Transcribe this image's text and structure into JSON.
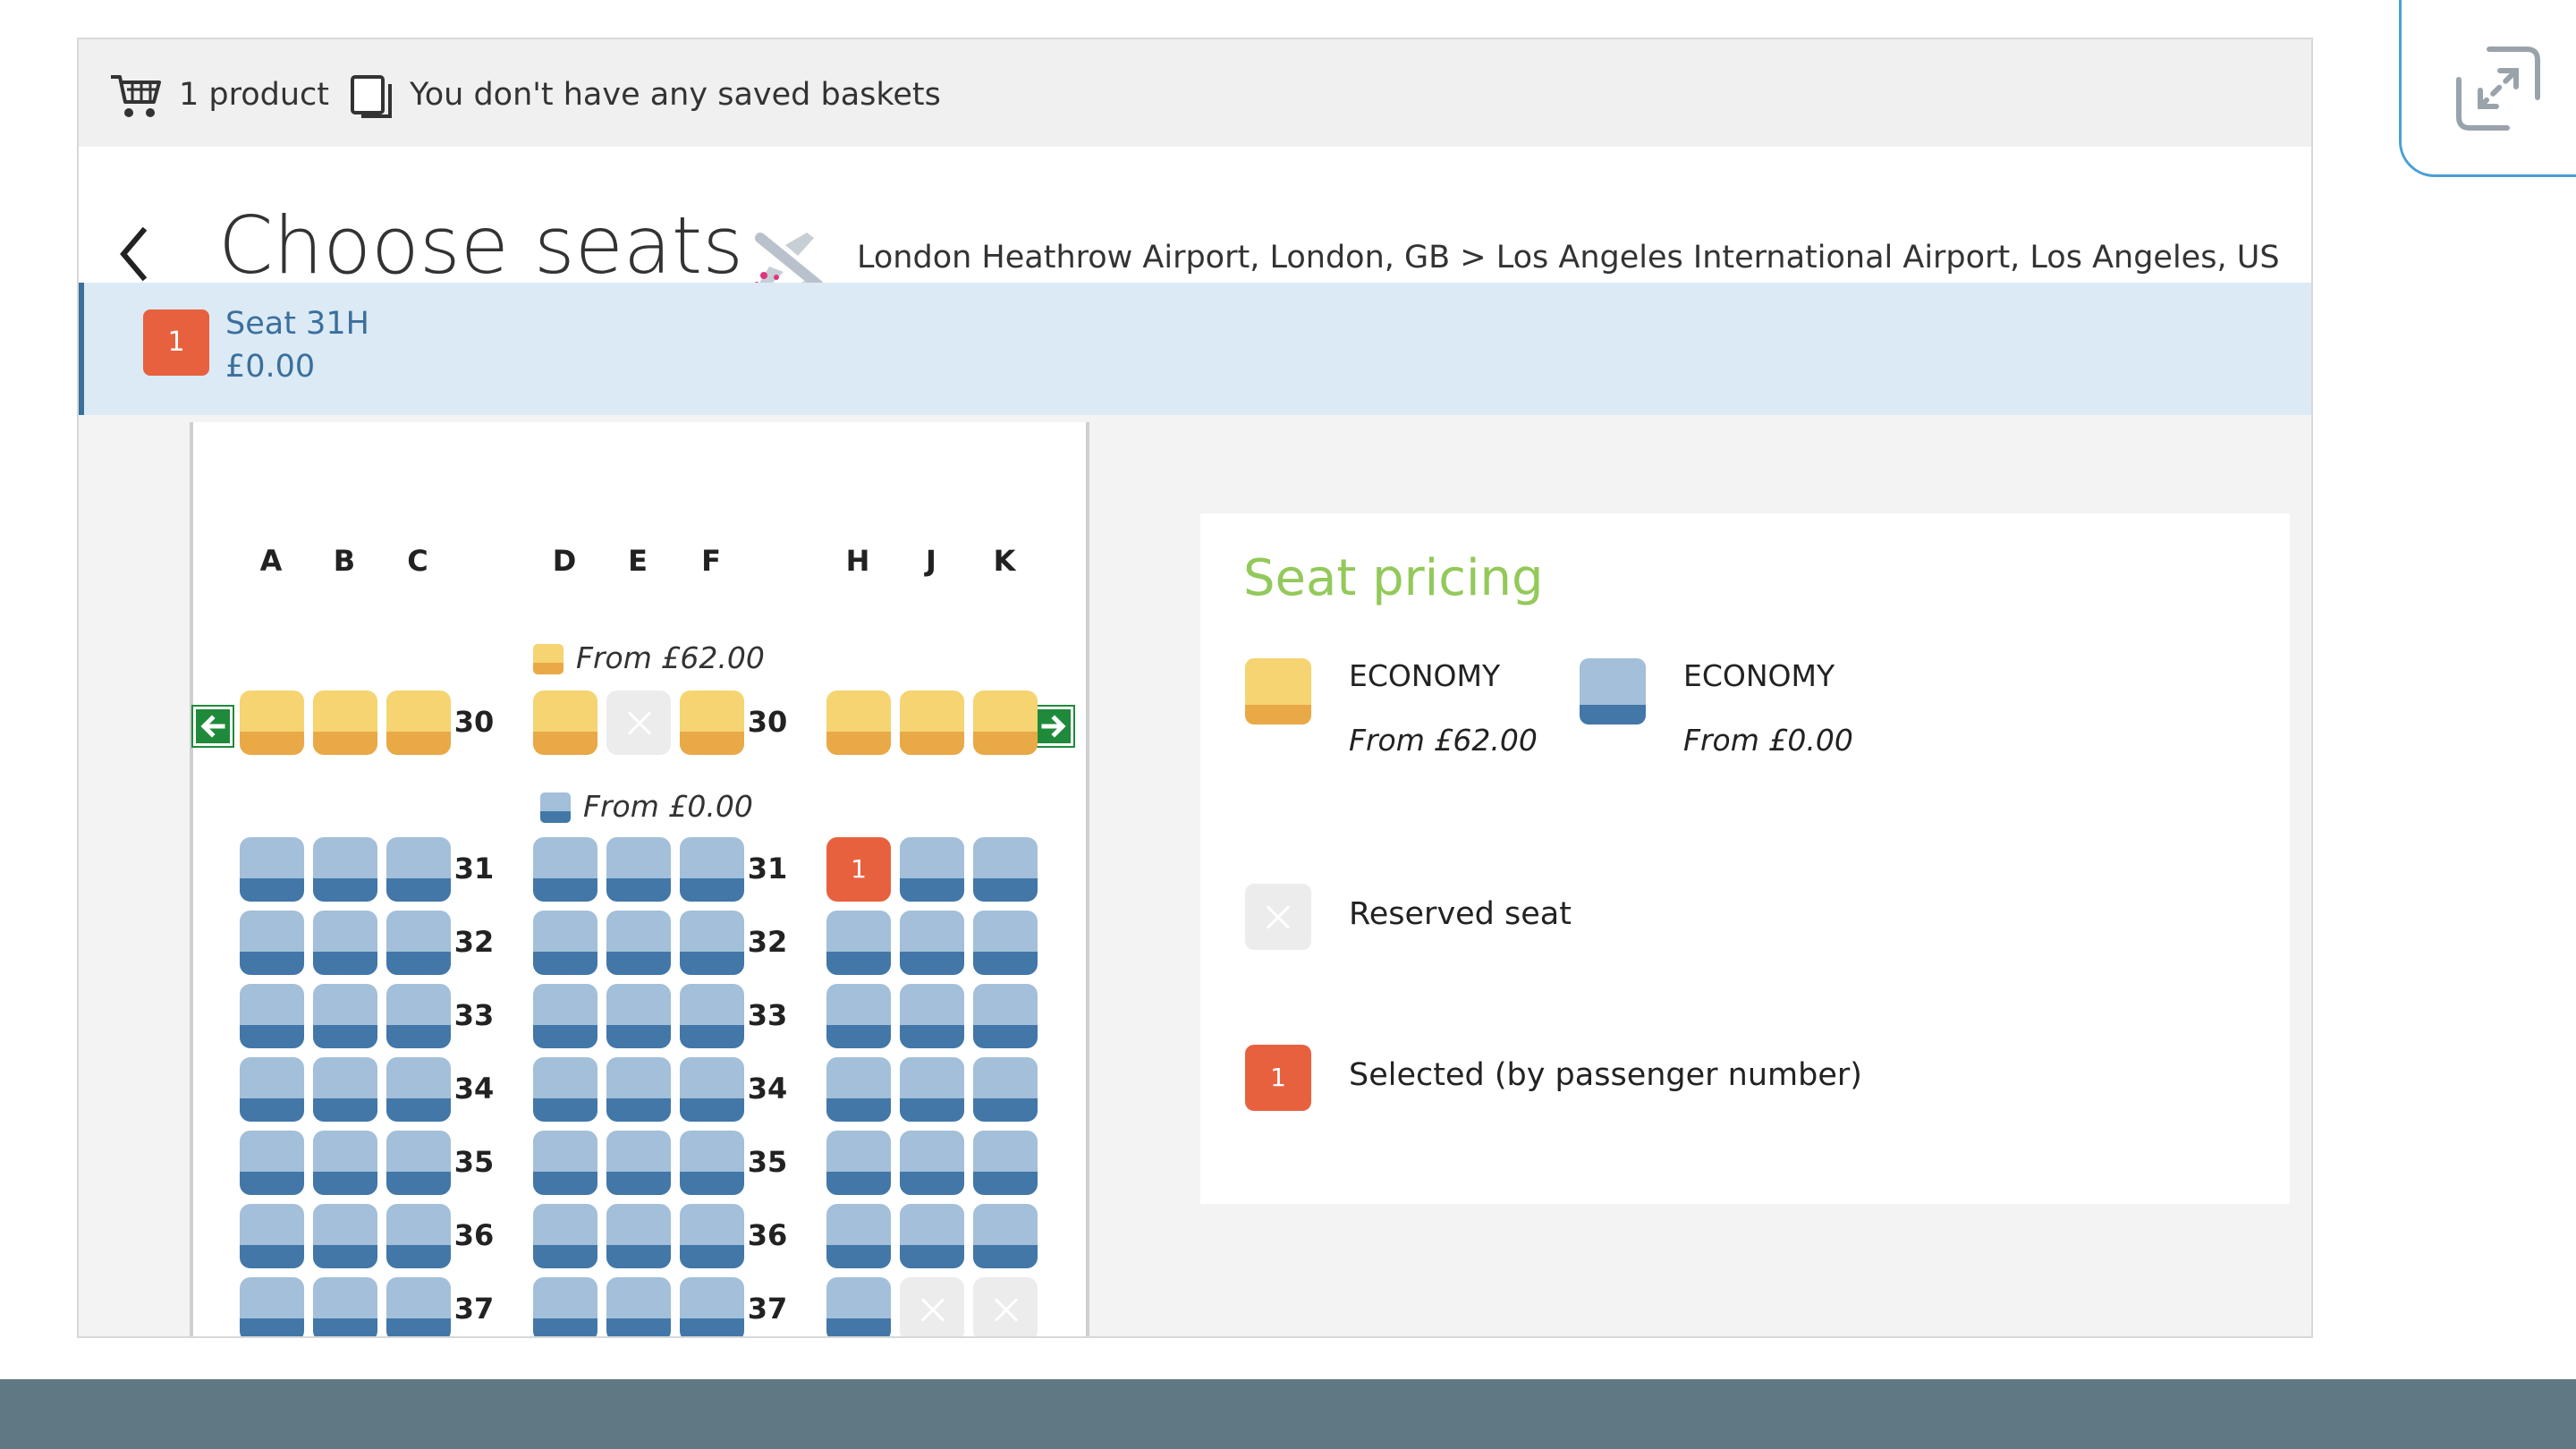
{
  "topbar": {
    "cart_icon": "shopping-cart-icon",
    "product_count": "1 product",
    "basket_icon": "saved-baskets-icon",
    "saved_baskets": "You don't have any saved baskets"
  },
  "header": {
    "back_icon": "chevron-left-icon",
    "title": "Choose seats",
    "plane_icon": "airplane-icon",
    "route": "London Heathrow Airport, London, GB > Los Angeles International Airport, Los Angeles, US"
  },
  "passenger": {
    "number": "1",
    "seat": "Seat 31H",
    "price": "£0.00"
  },
  "seat_map": {
    "columns_left": [
      "A",
      "B",
      "C"
    ],
    "columns_middle": [
      "D",
      "E",
      "F"
    ],
    "columns_right": [
      "H",
      "J",
      "K"
    ],
    "premium_price": "From £62.00",
    "standard_price": "From £0.00",
    "exit_left_icon": "exit-arrow-left-icon",
    "exit_right_icon": "exit-arrow-right-icon",
    "rows": [
      {
        "number": "30",
        "seats": [
          "yellow",
          "yellow",
          "yellow",
          "yellow",
          "reserved",
          "yellow",
          "yellow",
          "yellow",
          "yellow"
        ]
      },
      {
        "number": "31",
        "seats": [
          "blue",
          "blue",
          "blue",
          "blue",
          "blue",
          "blue",
          "selected",
          "blue",
          "blue"
        ]
      },
      {
        "number": "32",
        "seats": [
          "blue",
          "blue",
          "blue",
          "blue",
          "blue",
          "blue",
          "blue",
          "blue",
          "blue"
        ]
      },
      {
        "number": "33",
        "seats": [
          "blue",
          "blue",
          "blue",
          "blue",
          "blue",
          "blue",
          "blue",
          "blue",
          "blue"
        ]
      },
      {
        "number": "34",
        "seats": [
          "blue",
          "blue",
          "blue",
          "blue",
          "blue",
          "blue",
          "blue",
          "blue",
          "blue"
        ]
      },
      {
        "number": "35",
        "seats": [
          "blue",
          "blue",
          "blue",
          "blue",
          "blue",
          "blue",
          "blue",
          "blue",
          "blue"
        ]
      },
      {
        "number": "36",
        "seats": [
          "blue",
          "blue",
          "blue",
          "blue",
          "blue",
          "blue",
          "blue",
          "blue",
          "blue"
        ]
      },
      {
        "number": "37",
        "seats": [
          "blue",
          "blue",
          "blue",
          "blue",
          "blue",
          "blue",
          "blue",
          "reserved",
          "reserved"
        ]
      }
    ],
    "selected_label": "1"
  },
  "pricing": {
    "title": "Seat pricing",
    "premium_name": "ECONOMY",
    "premium_price": "From £62.00",
    "standard_name": "ECONOMY",
    "standard_price": "From £0.00",
    "reserved_label": "Reserved seat",
    "selected_badge": "1",
    "selected_label": "Selected (by passenger number)"
  },
  "colors": {
    "premium_seat": "#f5d471",
    "standard_seat": "#a3bfd9",
    "selected_seat": "#e8613f",
    "reserved_seat": "#ececec",
    "pricing_title": "#93c95a",
    "passenger_strip": "#dbeaf5",
    "exit_arrow": "#1f8a3a"
  },
  "expand_icon": "expand-diagonal-icon"
}
